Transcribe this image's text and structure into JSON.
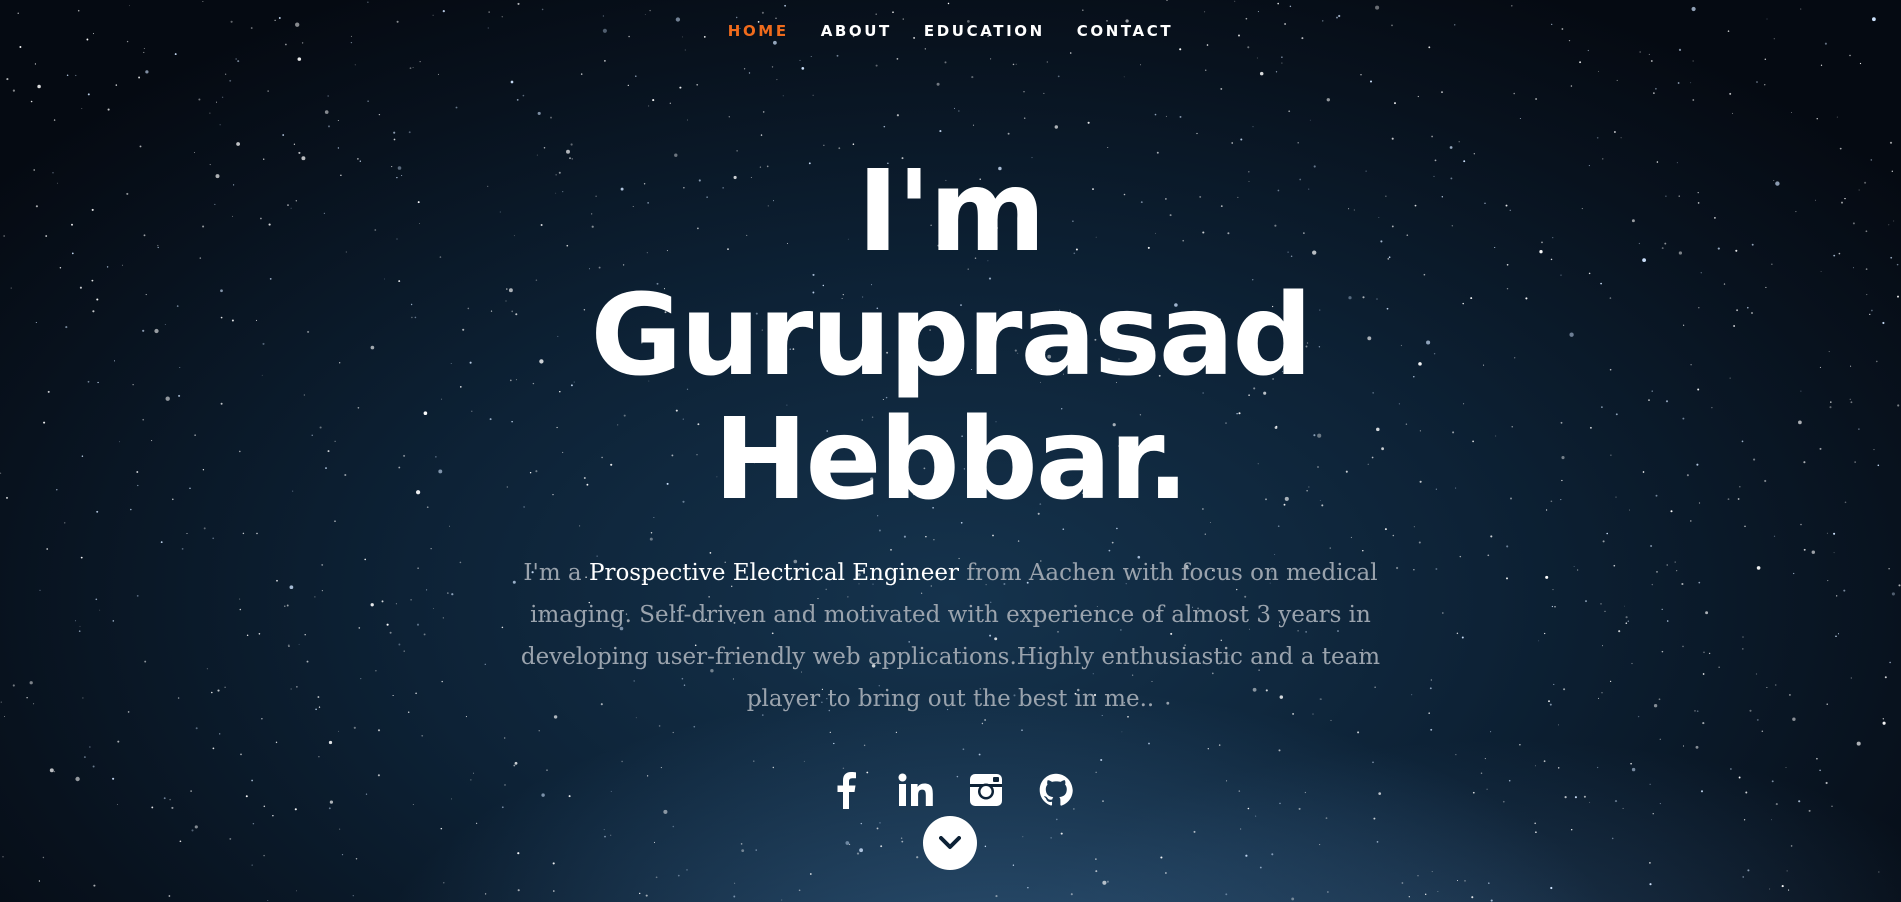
{
  "nav": {
    "items": [
      {
        "label": "HOME",
        "active": true
      },
      {
        "label": "ABOUT",
        "active": false
      },
      {
        "label": "EDUCATION",
        "active": false
      },
      {
        "label": "CONTACT",
        "active": false
      }
    ],
    "active_color": "#f06b1c"
  },
  "hero": {
    "title_line1": "I'm Guruprasad",
    "title_line2": "Hebbar.",
    "intro_prefix": "I'm a ",
    "intro_highlight": "Prospective Electrical Engineer",
    "intro_rest": " from Aachen with focus on medical imaging. Self-driven and motivated with experience of almost 3 years in developing user-friendly web applications.Highly enthusiastic and a team player to bring out the best in me.."
  },
  "social": [
    {
      "icon": "facebook-icon"
    },
    {
      "icon": "linkedin-icon"
    },
    {
      "icon": "instagram-icon"
    },
    {
      "icon": "github-icon"
    }
  ],
  "scroll": {
    "icon": "chevron-down-icon"
  }
}
